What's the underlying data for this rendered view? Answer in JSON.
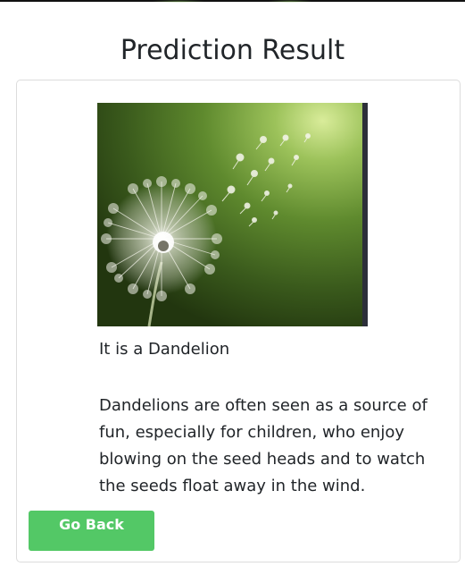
{
  "header": {
    "title": "Prediction Result"
  },
  "result": {
    "image_subject": "dandelion",
    "prediction_text": "It is a Dandelion",
    "description": "Dandelions are often seen as a source of fun, especially for children, who enjoy blowing on the seed heads and to watch the seeds float away in the wind."
  },
  "actions": {
    "go_back_label": "Go Back"
  },
  "colors": {
    "button_bg": "#53c866",
    "button_text": "#ffffff",
    "card_border": "#dcdcdc",
    "text": "#212529"
  }
}
